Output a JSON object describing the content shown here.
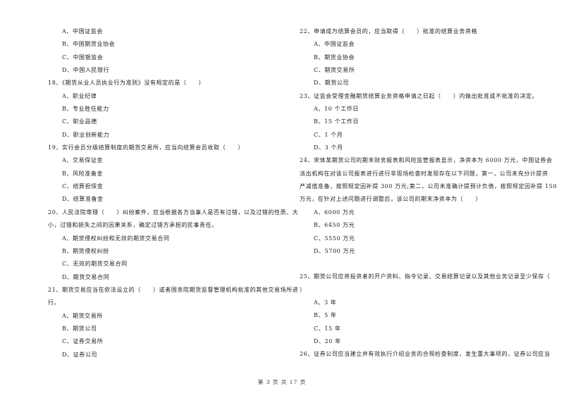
{
  "left_column": {
    "q17_tail": {
      "options": [
        "A、中国证监会",
        "B、中国期货业协会",
        "C、中国银监会",
        "D、中国人民银行"
      ]
    },
    "q18": {
      "stem": [
        "18、《期货从业人员执业行为准则》没有规定的是（　　）"
      ],
      "options": [
        "A、职业纪律",
        "B、专业胜任能力",
        "C、职业品德",
        "D、职业创新能力"
      ]
    },
    "q19": {
      "stem": [
        "19、实行会员分级结算制度的期货交易所，应当向结算会员收取（　　）"
      ],
      "options": [
        "A、交易保证金",
        "B、风险准备金",
        "C、结算担保金",
        "D、结算准备金"
      ]
    },
    "q20": {
      "stem": [
        "20、人民法院审理（　　）纠纷案件，应当根据各方当事人是否有过错，以及过错的性质、大",
        "小，过错和损失之间的因果关系，确定过错方承担的民事责任。"
      ],
      "options": [
        "A、期货侵权纠纷和无效的期货交易合同",
        "B、期货侵权纠纷",
        "C、无效的期货交易合同",
        "D、期货交易合同"
      ]
    },
    "q21": {
      "stem": [
        "21、期货交易应当在依法设立的（　　）或者国务院期货监督管理机构批准的其他交易场所进",
        "行。"
      ],
      "options": [
        "A、期货交易所",
        "B、期货公司",
        "C、证券交易所",
        "D、证券公司"
      ]
    }
  },
  "right_column": {
    "q22": {
      "stem": [
        "22、申请成为结算会员的，应当取得（　　）批准的结算业务资格"
      ],
      "options": [
        "A、中国证监会",
        "B、期货业协会",
        "C、期货交易所",
        "D、期货公司"
      ]
    },
    "q23": {
      "stem": [
        "23、证监会受理金融期货结算业务资格申请之日起（　　）内做出批准或不批准的决定。"
      ],
      "options": [
        "A、10 个工作日",
        "B、15 个工作日",
        "C、1 个月",
        "D、3 个月"
      ]
    },
    "q24": {
      "stem": [
        "24、宋体某期货公司的期末财务报表和风险监管报表显示，净资本为 6000 万元，中国证券会",
        "派出机构在对该公司报表进行进行非现场检查时发现存在以下问题，第一，公司未充分计提资",
        "产减值准备，按照规定因补提 300 万元;第二，公司未准确计提预计负债，按照规定因补提 150",
        "万元，在针对上述问题进行调整后，该公司的期末净资本为（　　）"
      ],
      "options": [
        "A、6000 万元",
        "B、6450 万元",
        "C、5550 万元",
        "D、5700 万元"
      ]
    },
    "q25": {
      "stem": [
        "25、期货公司应将投资者的开户资料、指令记录、交易结算记录以及其他业务记录至少保存（",
        "）"
      ],
      "options": [
        "A、3 年",
        "B、5 年",
        "C、15 年",
        "D、20 年"
      ]
    },
    "q26": {
      "stem": [
        "26、证券公司应当建立并有效执行介绍业务的合规检查制度，发生重大事项的，证券公司应当"
      ]
    }
  },
  "footer": {
    "page_label": "第 3 页 共 17 页"
  }
}
